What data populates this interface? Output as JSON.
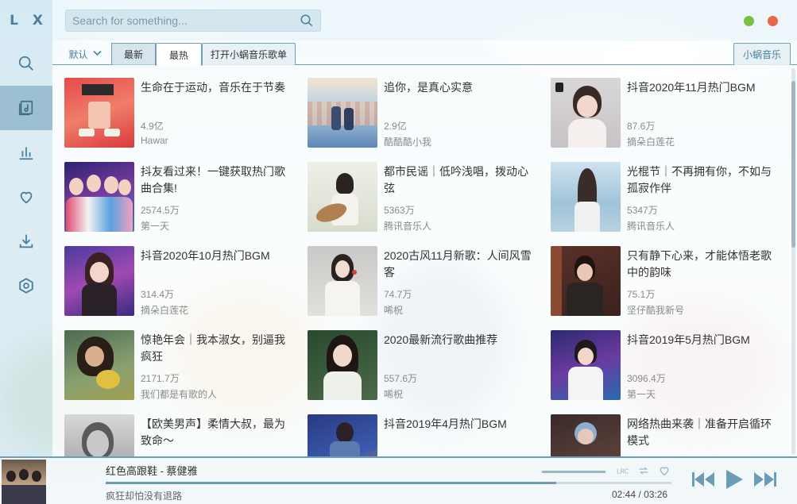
{
  "app": {
    "logo": "L X"
  },
  "sidebar": {
    "items": [
      {
        "icon": "search-icon"
      },
      {
        "icon": "music-library-icon"
      },
      {
        "icon": "chart-bars-icon"
      },
      {
        "icon": "heart-icon"
      },
      {
        "icon": "download-icon"
      },
      {
        "icon": "settings-icon"
      }
    ],
    "active_index": 1
  },
  "search": {
    "placeholder": "Search for something..."
  },
  "tabs": {
    "sort_label": "默认",
    "items": [
      "最新",
      "最热",
      "打开小蜗音乐歌单"
    ],
    "selected": "最热",
    "source": "小蜗音乐"
  },
  "playlists": [
    {
      "title": "生命在于运动，音乐在于节奏",
      "count": "4.9亿",
      "author": "Hawar"
    },
    {
      "title": "追你，是真心实意",
      "count": "2.9亿",
      "author": "酷酷酷小我"
    },
    {
      "title": "抖音2020年11月热门BGM",
      "count": "87.6万",
      "author": "摘朵白莲花"
    },
    {
      "title": "抖友看过来！一键获取热门歌曲合集!",
      "count": "2574.5万",
      "author": "第一天"
    },
    {
      "title": "都市民谣｜低吟浅唱，拨动心弦",
      "count": "5363万",
      "author": "腾讯音乐人"
    },
    {
      "title": "光棍节｜不再拥有你，不如与孤寂作伴",
      "count": "5347万",
      "author": "腾讯音乐人"
    },
    {
      "title": "抖音2020年10月热门BGM",
      "count": "314.4万",
      "author": "摘朵白莲花"
    },
    {
      "title": "2020古风11月新歌：人间风雪客",
      "count": "74.7万",
      "author": "唏柷"
    },
    {
      "title": "只有静下心来，才能体悟老歌中的韵味",
      "count": "75.1万",
      "author": "坚仔酷我新号"
    },
    {
      "title": "惊艳年会｜我本淑女，别逼我疯狂",
      "count": "2171.7万",
      "author": "我们都是有歌的人"
    },
    {
      "title": "2020最新流行歌曲推荐",
      "count": "557.6万",
      "author": "唏柷"
    },
    {
      "title": "抖音2019年5月热门BGM",
      "count": "3096.4万",
      "author": "第一天"
    },
    {
      "title": "【欧美男声】柔情大叔，最为致命～",
      "count": "",
      "author": ""
    },
    {
      "title": "抖音2019年4月热门BGM",
      "count": "",
      "author": ""
    },
    {
      "title": "网络热曲来袭｜准备开启循环模式",
      "count": "",
      "author": ""
    }
  ],
  "player": {
    "song": "红色高跟鞋 - 蔡健雅",
    "lyric": "疯狂却怕没有退路",
    "current_time": "02:44",
    "separator": "/",
    "total_time": "03:26",
    "progress": 0.796,
    "volume": 1.0,
    "lrc_label": "LRC"
  },
  "colors": {
    "accent": "#4a7fa0",
    "active_nav": "#5a8faa",
    "border": "#6f9fb4"
  }
}
